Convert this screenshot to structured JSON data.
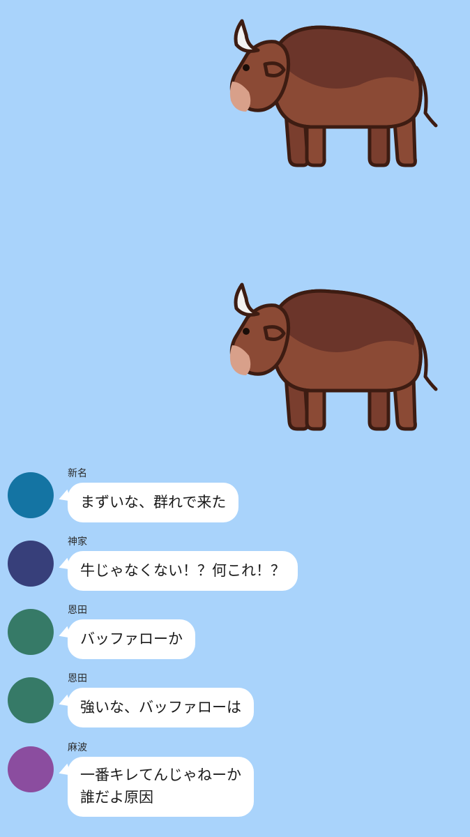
{
  "stickers": [
    {
      "name": "buffalo-sticker",
      "icon": "buffalo-icon"
    },
    {
      "name": "buffalo-sticker",
      "icon": "buffalo-icon"
    }
  ],
  "colors": {
    "background": "#a9d3fb",
    "bubble": "#ffffff",
    "buffalo_body": "#8b4a35",
    "buffalo_mane": "#6b352a"
  },
  "messages": [
    {
      "sender": "新名",
      "avatar_color": "#1474a3",
      "lines": [
        "まずいな、群れで来た"
      ]
    },
    {
      "sender": "神家",
      "avatar_color": "#373f7a",
      "lines": [
        "牛じゃなくない！？何これ！？"
      ]
    },
    {
      "sender": "恩田",
      "avatar_color": "#367a67",
      "lines": [
        "バッファローか"
      ]
    },
    {
      "sender": "恩田",
      "avatar_color": "#367a67",
      "lines": [
        "強いな、バッファローは"
      ]
    },
    {
      "sender": "麻波",
      "avatar_color": "#8b4d9f",
      "lines": [
        "一番キレてんじゃねーか",
        "誰だよ原因"
      ]
    }
  ]
}
